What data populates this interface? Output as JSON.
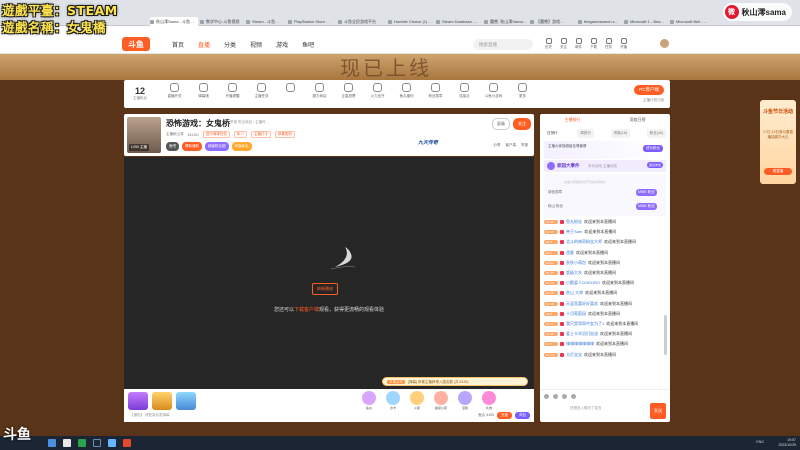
{
  "overlay": {
    "line1": "遊戲平臺：STEAM",
    "line2": "遊戲名稱：女鬼橋"
  },
  "weibo": {
    "handle": "秋山澪sama"
  },
  "browser": {
    "tabs": [
      "秋山澪Sama - 斗鱼…",
      "数学中心-斗鱼视频",
      "Steam - 斗鱼…",
      "PlayStation Store…",
      "斗鱼全民游戏平台",
      "Humble Choice (1)…",
      "Steam Database -…",
      "魔兽, 秋山澪Sama…",
      "【魔兽】游戏…",
      "thegamesearch.c…",
      "Minecraft 1 - Bea…",
      "Microsoft Bell - …"
    ]
  },
  "header": {
    "logo": "斗鱼",
    "nav": [
      "首页",
      "直播",
      "分类",
      "视频",
      "游戏",
      "鱼吧"
    ],
    "search_placeholder": "搜索直播",
    "icons": [
      "历史",
      "关注",
      "邮件",
      "下载",
      "任务",
      "开播"
    ]
  },
  "banner": {
    "text": "现已上线"
  },
  "giftbar": {
    "count": "12",
    "count_label": "主播粉丝",
    "items": [
      "直播开关",
      "弹幕墙",
      "开播提醒",
      "主播任务",
      "",
      "魔力商店",
      "正直投票",
      "火力全开",
      "鱼丸福利",
      "粉丝勋章",
      "连接点",
      "斗鱼小游戏",
      "更多"
    ],
    "pc_button": "PC客户端",
    "pc_sub": "主播计划订阅"
  },
  "room": {
    "avatar_level": "LV50  主播",
    "title": "恐怖游戏：女鬼桥",
    "report": "举报  附近商品 • 主播时...",
    "anchor": "主播秋山澪",
    "heat": "461151",
    "tag1": "进行简单任务",
    "tag2": "年少",
    "tag3": "主播打卡",
    "tag4": "恭喜发财",
    "badges": [
      "鱼吧",
      "帮助通知",
      "超级粉丝团",
      "贵族标志"
    ],
    "btn_mute": "屏蔽",
    "btn_follow": "关注",
    "brand": "九天传奇",
    "acts": [
      "分享",
      "客户端",
      "举报"
    ]
  },
  "video": {
    "button": "刷新播放",
    "message_prefix": "您还可以",
    "message_link": "下载客户端",
    "message_suffix": "观看，获得更流畅的观看体验",
    "notice_tag": "本场活动",
    "notice": "[弹幕] 恭喜主播获得入围名额 (共 8125)"
  },
  "bottombar": {
    "input": "【通知】 请登录后发弹幕",
    "gifts": [
      "鱼丸",
      "办卡",
      "火箭",
      "超级火箭",
      "宝箱",
      "礼物"
    ],
    "btn_recharge": "充值",
    "btn_backpack": "背包",
    "fish": "鱼丸 5193"
  },
  "rpanel": {
    "toptabs": [
      "主播排行",
      "贡献日榜"
    ],
    "subtabs": [
      "日排行",
      "周排行",
      "贵族(16)",
      "粉丝(40)"
    ],
    "ad_title": "主播大家族超级至尊套餐",
    "ad_button": "成为粉丝",
    "event_title": "家园大事件",
    "event_desc": "本月活动 主播动态",
    "event_button": "报名参加",
    "row1": "绿色勋章",
    "row1_btn": "MINE 粉丝",
    "row2": "秋山 粉丝",
    "row2_btn": "MINE 粉丝",
    "dim": "主播大家族成员已开启房间统计",
    "chat": [
      {
        "lv": "LV 25",
        "name": "鱼丸粉丝",
        "text": "欢迎来到本直播间"
      },
      {
        "lv": "LV 17",
        "name": "帝王Sam",
        "text": "欢迎来到本直播间"
      },
      {
        "lv": "LV 9",
        "name": "北斗的神奇粉丝大师",
        "text": "欢迎来到本直播间"
      },
      {
        "lv": "LV 6",
        "name": "游客",
        "text": "欢迎来到本直播间"
      },
      {
        "lv": "LV 22",
        "name": "秋秋小萌包",
        "text": "欢迎来到本直播间"
      },
      {
        "lv": "LV 16",
        "name": "超级大灰",
        "text": "欢迎来到本直播间"
      },
      {
        "lv": "LV 13",
        "name": "小酷爱人DORORO",
        "text": "欢迎来到本直播间"
      },
      {
        "lv": "LV 25",
        "name": "秋山 大帅",
        "text": "欢迎来到本直播间"
      },
      {
        "lv": "LV 18",
        "name": "天涯悲喜好好喜欢",
        "text": "欢迎来到本直播间"
      },
      {
        "lv": "LV 8",
        "name": "十月葡萄园",
        "text": "欢迎来到本直播间"
      },
      {
        "lv": "LV 17",
        "name": "我只是哥哥中女为了1",
        "text": "欢迎来到本直播间"
      },
      {
        "lv": "LV 18",
        "name": "爱士卡学员们加油",
        "text": "欢迎来到本直播间"
      },
      {
        "lv": "LV 7",
        "name": "嗨嗨嗨嗨嗨嗨嗨",
        "text": "欢迎来到本直播间"
      },
      {
        "lv": "LV 14",
        "name": "大灯宝宝",
        "text": "欢迎来到本直播间"
      }
    ],
    "input": "还想进入聊天了发言",
    "send": "发送"
  },
  "sidead": {
    "title": "斗鱼节日活动",
    "desc": "17日-19日参与看直播抽豪华大礼",
    "button": "看直播"
  },
  "taskbar": {
    "logo": "斗鱼",
    "lang": "ENG",
    "time": "19:57",
    "date": "2023/10/29"
  },
  "colors": {
    "accent": "#ff5d23",
    "purple": "#7b5cff",
    "overlay": "#ffe44d"
  }
}
